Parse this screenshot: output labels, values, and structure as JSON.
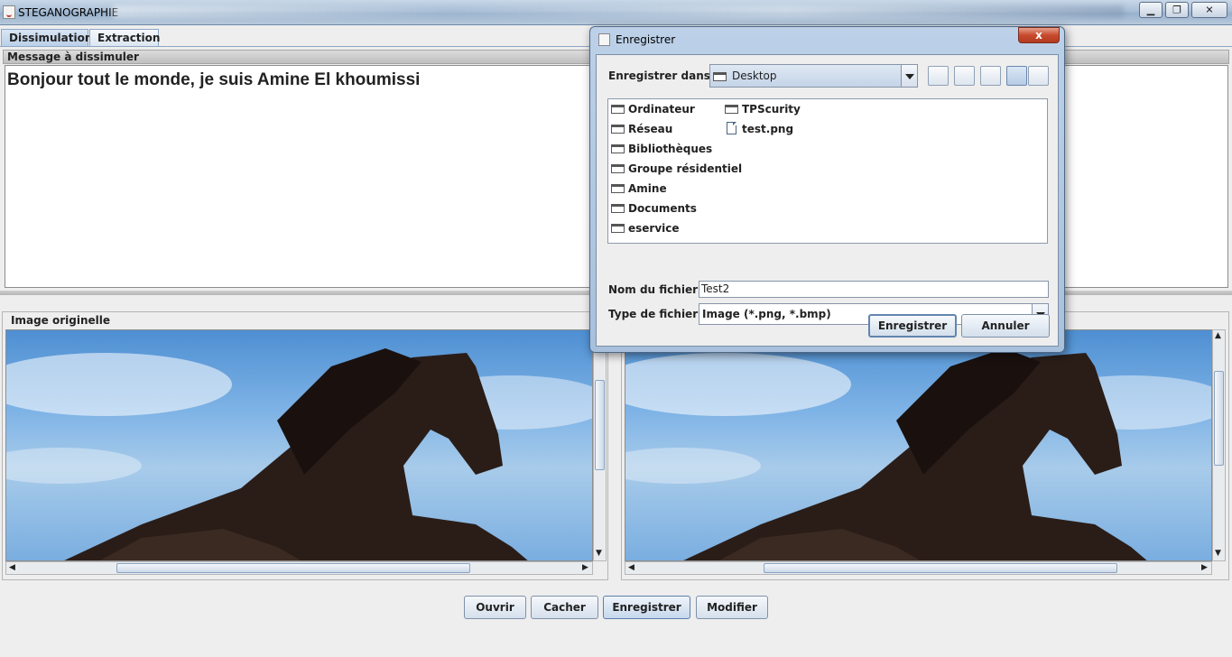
{
  "window": {
    "title": "STEGANOGRAPHIE"
  },
  "tabs": [
    {
      "label": "Dissimulation",
      "active": true
    },
    {
      "label": "Extraction",
      "active": false
    }
  ],
  "message_panel": {
    "header": "Message à dissimuler",
    "text": "Bonjour tout le monde, je suis Amine El khoumissi"
  },
  "image_panel": {
    "legend": "Image originelle"
  },
  "buttons": {
    "ouvrir": "Ouvrir",
    "cacher": "Cacher",
    "enregistrer": "Enregistrer",
    "modifier": "Modifier"
  },
  "dialog": {
    "title": "Enregistrer",
    "close": "x",
    "save_in_label": "Enregistrer dans :",
    "save_in_value": "Desktop",
    "items_col1": [
      {
        "name": "Ordinateur",
        "type": "folder"
      },
      {
        "name": "Réseau",
        "type": "folder"
      },
      {
        "name": "Bibliothèques",
        "type": "folder"
      },
      {
        "name": "Groupe résidentiel",
        "type": "folder"
      },
      {
        "name": "Amine",
        "type": "folder"
      },
      {
        "name": "Documents",
        "type": "folder"
      },
      {
        "name": "eservice",
        "type": "folder"
      }
    ],
    "items_col2": [
      {
        "name": "TPScurity",
        "type": "folder"
      },
      {
        "name": "test.png",
        "type": "file"
      }
    ],
    "filename_label": "Nom du fichier :",
    "filename_value": "Test2",
    "filetype_label": "Type de fichier :",
    "filetype_value": "Image (*.png, *.bmp)",
    "save_button": "Enregistrer",
    "cancel_button": "Annuler"
  },
  "colors": {
    "accent": "#6285b0",
    "close": "#c74a2d",
    "sky": "#7eb3e6"
  }
}
